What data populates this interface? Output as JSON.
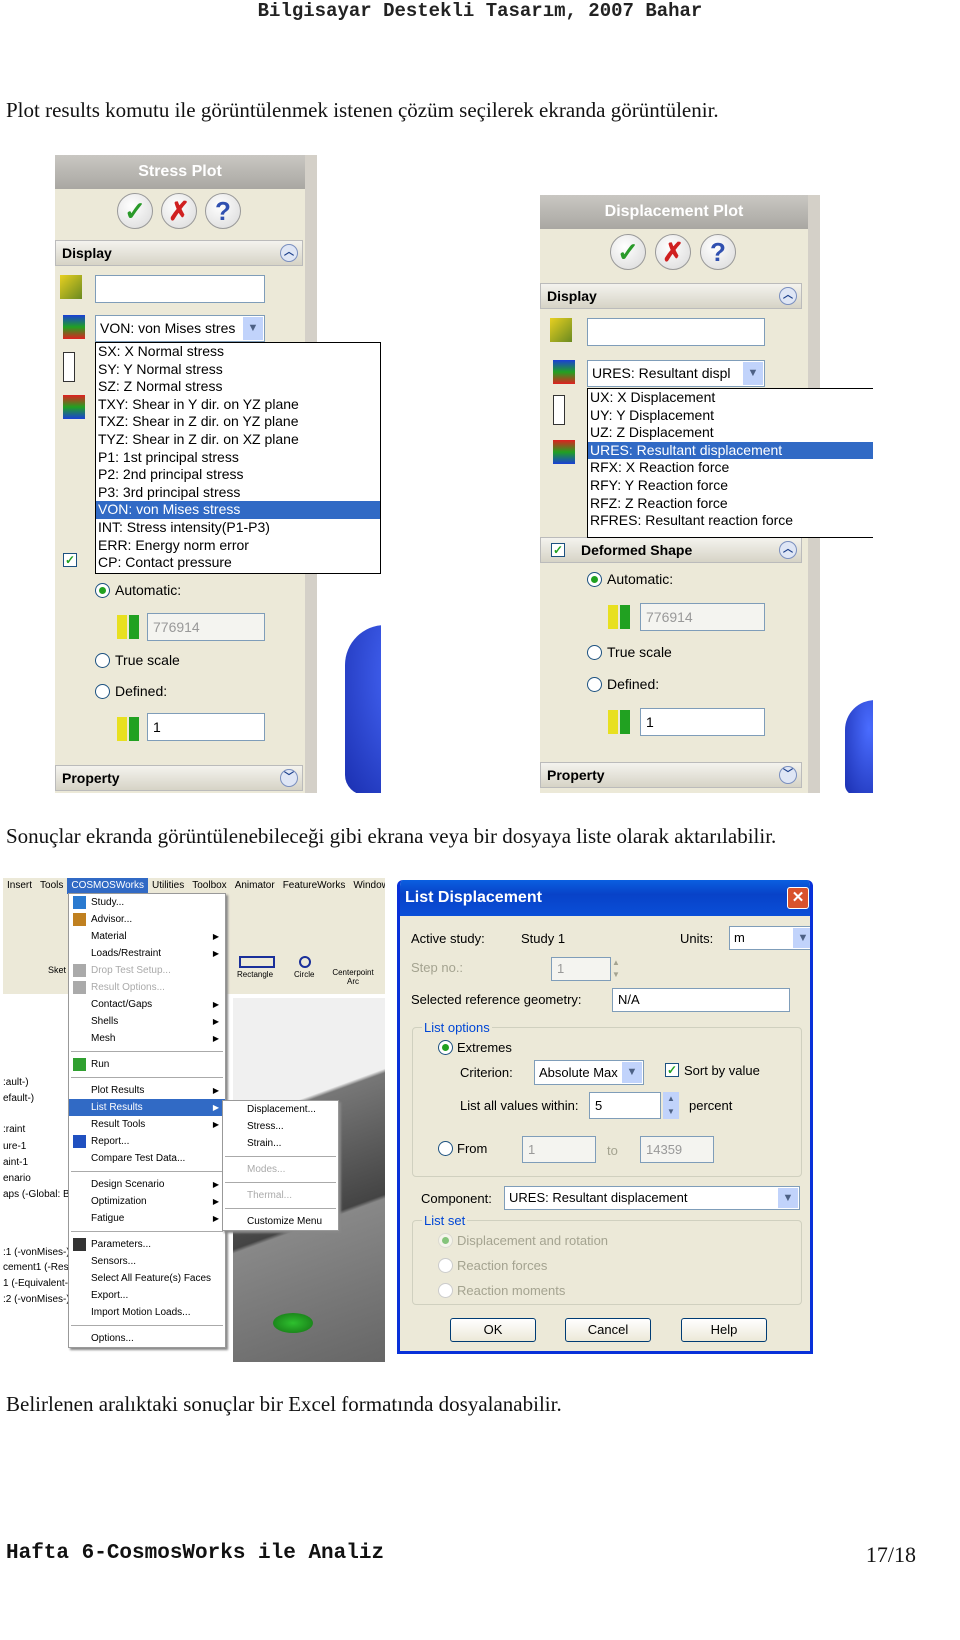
{
  "header": "Bilgisayar Destekli Tasarım, 2007 Bahar",
  "paragraphs": [
    "Plot results komutu ile görüntülenmek istenen çözüm seçilerek ekranda görüntülenir.",
    "Sonuçlar ekranda görüntülenebileceği gibi ekrana veya bir dosyaya liste olarak aktarılabilir.",
    "Belirlenen aralıktaki sonuçlar bir Excel formatında dosyalanabilir."
  ],
  "footer": {
    "left": "Hafta 6-CosmosWorks ile Analiz",
    "right": "17/18"
  },
  "stress_plot": {
    "title": "Stress Plot",
    "display_label": "Display",
    "dropdown": "VON: von Mises stres",
    "options": [
      "SX: X Normal stress",
      "SY: Y Normal stress",
      "SZ: Z Normal stress",
      "TXY: Shear in Y dir. on YZ plane",
      "TXZ: Shear in Z dir. on YZ plane",
      "TYZ: Shear in Z dir. on XZ plane",
      "P1: 1st principal stress",
      "P2: 2nd principal stress",
      "P3: 3rd principal stress",
      "VON: von Mises stress",
      "INT: Stress intensity(P1-P3)",
      "ERR: Energy norm error",
      "CP: Contact pressure"
    ],
    "selected_index": 9,
    "automatic_label": "Automatic:",
    "automatic_value": "776914",
    "true_scale_label": "True scale",
    "defined_label": "Defined:",
    "defined_value": "1",
    "property_label": "Property"
  },
  "displacement_plot": {
    "title": "Displacement Plot",
    "display_label": "Display",
    "dropdown": "URES: Resultant displ",
    "options": [
      "UX: X Displacement",
      "UY: Y Displacement",
      "UZ: Z Displacement",
      "URES: Resultant displacement",
      "RFX: X Reaction force",
      "RFY: Y Reaction force",
      "RFZ: Z Reaction force",
      "RFRES: Resultant reaction force"
    ],
    "selected_index": 3,
    "deformed_label": "Deformed Shape",
    "automatic_label": "Automatic:",
    "automatic_value": "776914",
    "true_scale_label": "True scale",
    "defined_label": "Defined:",
    "defined_value": "1",
    "property_label": "Property"
  },
  "menu_screenshot": {
    "menubar": [
      "Insert",
      "Tools",
      "COSMOSWorks",
      "Utilities",
      "Toolbox",
      "Animator",
      "FeatureWorks",
      "Window"
    ],
    "toolbar": [
      "Sket",
      "Rectangle",
      "Circle",
      "Centerpoint Arc"
    ],
    "tree": [
      ":ault-)",
      "efault-)",
      ":raint",
      "ure-1",
      "aint-1",
      "enario",
      "aps (-Global: B",
      ":1 (-vonMises-)",
      "cement1 (-Res",
      "1 (-Equivalent-)",
      ":2 (-vonMises-)"
    ],
    "menu": [
      [
        "Study...",
        "",
        "search"
      ],
      [
        "Advisor...",
        "",
        "advisor"
      ],
      [
        "Material",
        "sub",
        ""
      ],
      [
        "Loads/Restraint",
        "sub",
        ""
      ],
      [
        "Drop Test Setup...",
        "dis",
        "drop"
      ],
      [
        "Result Options...",
        "dis",
        "result"
      ],
      [
        "Contact/Gaps",
        "sub",
        ""
      ],
      [
        "Shells",
        "sub",
        ""
      ],
      [
        "Mesh",
        "sub",
        ""
      ],
      [
        "-"
      ],
      [
        "Run",
        "",
        "run"
      ],
      [
        "-"
      ],
      [
        "Plot Results",
        "sub",
        ""
      ],
      [
        "List Results",
        "hl",
        ""
      ],
      [
        "Result Tools",
        "sub",
        ""
      ],
      [
        "Report...",
        "",
        "report"
      ],
      [
        "Compare Test Data...",
        "",
        ""
      ],
      [
        "-"
      ],
      [
        "Design Scenario",
        "sub",
        ""
      ],
      [
        "Optimization",
        "sub",
        ""
      ],
      [
        "Fatigue",
        "sub",
        ""
      ],
      [
        "-"
      ],
      [
        "Parameters...",
        "",
        "params"
      ],
      [
        "Sensors...",
        "",
        ""
      ],
      [
        "Select All Feature(s) Faces",
        "",
        ""
      ],
      [
        "Export...",
        "",
        ""
      ],
      [
        "Import Motion Loads...",
        "",
        ""
      ],
      [
        "-"
      ],
      [
        "Options...",
        "",
        ""
      ]
    ],
    "submenu": [
      [
        "Displacement...",
        ""
      ],
      [
        "Stress...",
        ""
      ],
      [
        "Strain...",
        ""
      ],
      [
        "-"
      ],
      [
        "Modes...",
        "dis"
      ],
      [
        "-"
      ],
      [
        "Thermal...",
        "dis"
      ],
      [
        "-"
      ],
      [
        "Customize Menu",
        ""
      ]
    ]
  },
  "dialog": {
    "title": "List Displacement",
    "active_study_label": "Active study:",
    "active_study": "Study 1",
    "units_label": "Units:",
    "units": "m",
    "step_label": "Step no.:",
    "step": "1",
    "ref_label": "Selected reference geometry:",
    "ref": "N/A",
    "list_options": "List options",
    "extremes": "Extremes",
    "criterion_label": "Criterion:",
    "criterion": "Absolute Max",
    "sort_label": "Sort by value",
    "within_label": "List all values within:",
    "within": "5",
    "percent": "percent",
    "from_label": "From",
    "from": "1",
    "to_label": "to",
    "to": "14359",
    "component_label": "Component:",
    "component": "URES: Resultant displacement",
    "list_set": "List set",
    "set_options": [
      "Displacement and rotation",
      "Reaction forces",
      "Reaction moments"
    ],
    "ok": "OK",
    "cancel": "Cancel",
    "help": "Help"
  },
  "colors": {
    "highlight": "#316ac5",
    "panel": "#ece9d8",
    "titlebar": "#0842c8",
    "model": "#1a3fd6"
  }
}
